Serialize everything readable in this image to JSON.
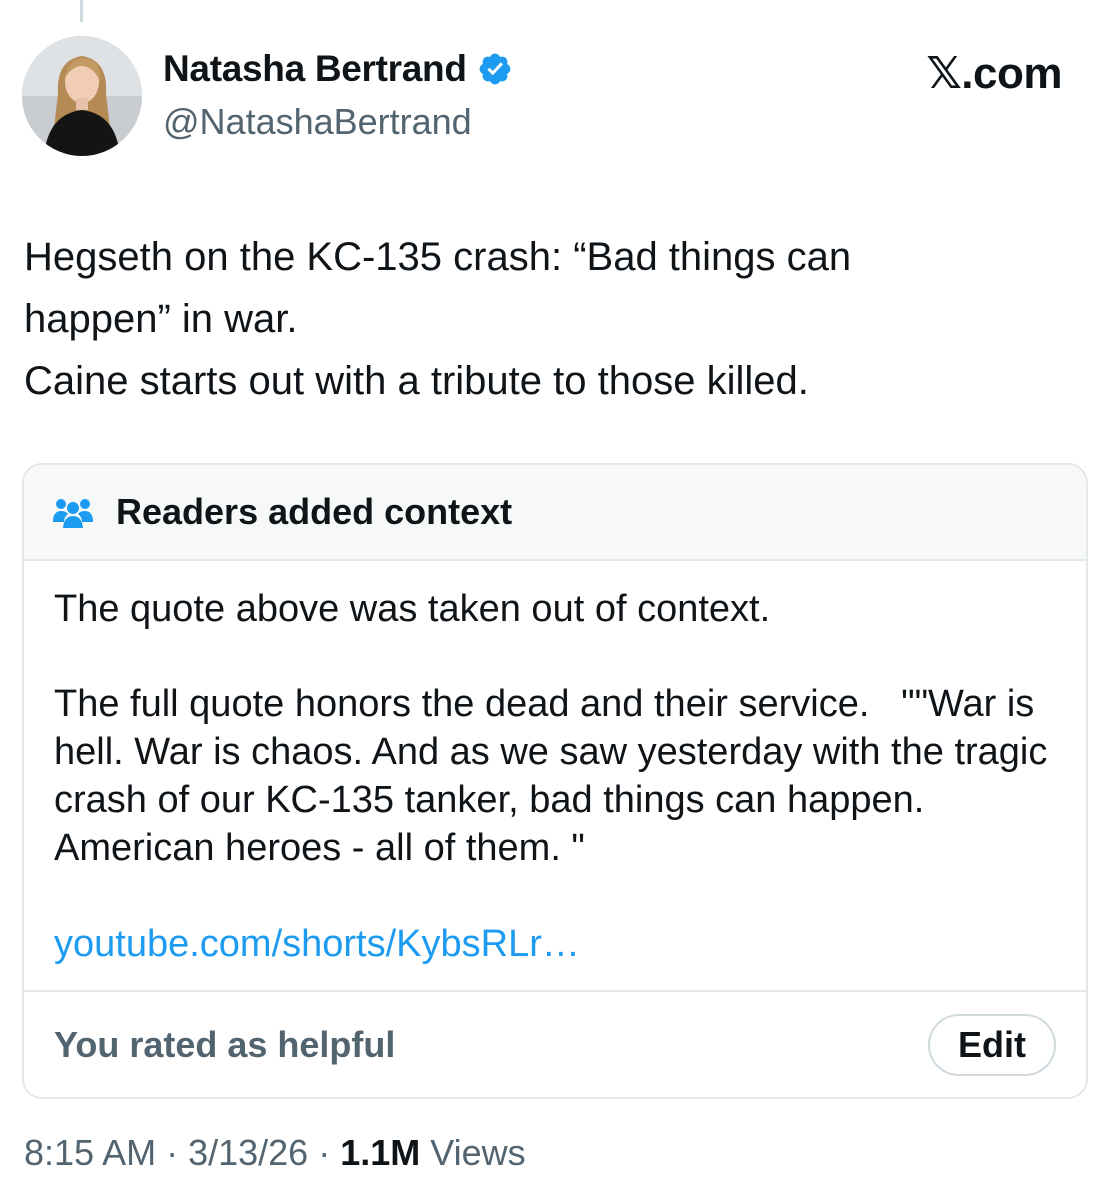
{
  "brand": "𝕏.com",
  "author": {
    "name": "Natasha Bertrand",
    "handle": "@NatashaBertrand",
    "verified": true
  },
  "tweet": {
    "text": "Hegseth on the KC-135 crash: “Bad things can\nhappen” in war.\nCaine starts out with a tribute to those killed.",
    "time": "8:15 AM",
    "date": "3/13/26",
    "separator": " · ",
    "views_count": "1.1M",
    "views_label": " Views"
  },
  "community_note": {
    "header": "Readers added context",
    "paragraph1": "The quote above was taken out of context.",
    "paragraph2": "The full quote honors the dead and their service.   \"\"War is hell. War is chaos. And as we saw yesterday with the tragic crash of our KC-135 tanker, bad things can happen. American heroes - all of them. \"",
    "link": "youtube.com/shorts/KybsRLr…",
    "rating_status": "You rated as helpful",
    "edit_label": "Edit"
  },
  "colors": {
    "text": "#0f1419",
    "secondary": "#536471",
    "link": "#1d9bf0",
    "verified": "#1d9bf0",
    "border": "#e4e8eb",
    "header_bg": "#f7f9f9"
  }
}
